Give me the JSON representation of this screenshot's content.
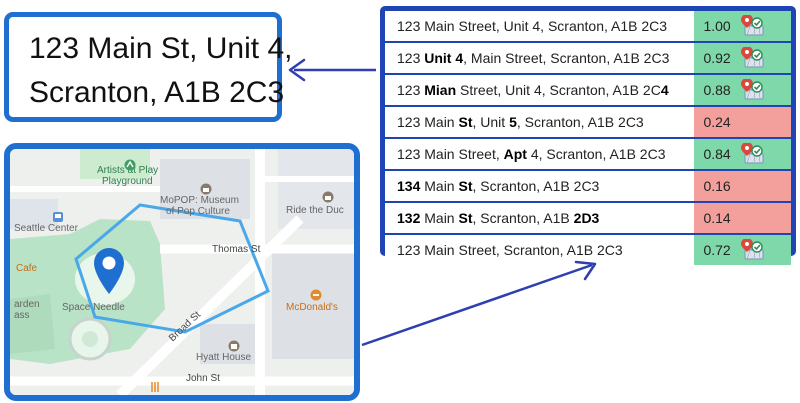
{
  "address": {
    "lines": [
      "123 Main St, Unit 4,",
      "Scranton, A1B 2C3"
    ]
  },
  "matches": [
    {
      "parts": [
        {
          "t": "123 Main Street, Unit 4, Scranton, A1B 2C3",
          "b": false
        }
      ],
      "score": "1.00",
      "status": "good",
      "icon": "map-pin-check-icon"
    },
    {
      "parts": [
        {
          "t": "123 ",
          "b": false
        },
        {
          "t": "Unit 4",
          "b": true
        },
        {
          "t": ", Main Street, Scranton, A1B 2C3",
          "b": false
        }
      ],
      "score": "0.92",
      "status": "good",
      "icon": "map-pin-check-icon"
    },
    {
      "parts": [
        {
          "t": "123 ",
          "b": false
        },
        {
          "t": "Mian",
          "b": true
        },
        {
          "t": " Street, Unit 4, Scranton, A1B 2C",
          "b": false
        },
        {
          "t": "4",
          "b": true
        }
      ],
      "score": "0.88",
      "status": "good",
      "icon": "map-pin-check-icon"
    },
    {
      "parts": [
        {
          "t": "123 Main ",
          "b": false
        },
        {
          "t": "St",
          "b": true
        },
        {
          "t": ", Unit ",
          "b": false
        },
        {
          "t": "5",
          "b": true
        },
        {
          "t": ", Scranton, A1B 2C3",
          "b": false
        }
      ],
      "score": "0.24",
      "status": "bad"
    },
    {
      "parts": [
        {
          "t": "123 Main Street, ",
          "b": false
        },
        {
          "t": "Apt",
          "b": true
        },
        {
          "t": " 4, Scranton, A1B 2C3",
          "b": false
        }
      ],
      "score": "0.84",
      "status": "good",
      "icon": "map-pin-check-icon"
    },
    {
      "parts": [
        {
          "t": "134",
          "b": true
        },
        {
          "t": " Main ",
          "b": false
        },
        {
          "t": "St",
          "b": true
        },
        {
          "t": ", Scranton, A1B 2C3",
          "b": false
        }
      ],
      "score": "0.16",
      "status": "bad"
    },
    {
      "parts": [
        {
          "t": "132",
          "b": true
        },
        {
          "t": " Main ",
          "b": false
        },
        {
          "t": "St",
          "b": true
        },
        {
          "t": ", Scranton, A1B ",
          "b": false
        },
        {
          "t": "2D3",
          "b": true
        }
      ],
      "score": "0.14",
      "status": "bad"
    },
    {
      "parts": [
        {
          "t": "123 Main Street, Scranton, A1B 2C3",
          "b": false
        }
      ],
      "score": "0.72",
      "status": "good",
      "icon": "map-pin-check-icon"
    }
  ],
  "map": {
    "labels": {
      "artists": "Artists at Play",
      "playground": "Playground",
      "mopop1": "MoPOP: Museum",
      "mopop2": "of Pop Culture",
      "ride": "Ride the Duc",
      "seattle_center": "Seattle Center",
      "cafe": "Cafe",
      "garden": "arden",
      "glass": "ass",
      "space_needle": "Space Needle",
      "mcdonalds": "McDonald's",
      "hyatt": "Hyatt House"
    },
    "streets": {
      "thomas": "Thomas St",
      "broad": "Broad St",
      "john": "John St"
    },
    "icons": [
      "map-pin-icon",
      "museum-icon",
      "restaurant-icon",
      "hotel-icon",
      "playground-icon",
      "train-icon"
    ]
  },
  "colors": {
    "frame_blue": "#1f6fd1",
    "table_blue": "#1f45b4",
    "good": "#7fd8a9",
    "bad": "#f3a09d",
    "arrow": "#2f3fb0",
    "route": "#4aa8e8"
  }
}
